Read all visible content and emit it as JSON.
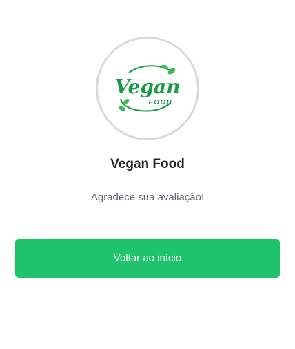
{
  "logo": {
    "script_text": "Vegan",
    "sub_text": "FOOD",
    "brand_color": "#1a9a45"
  },
  "store": {
    "name": "Vegan Food"
  },
  "message": {
    "thanks": "Agradece sua avaliação!"
  },
  "actions": {
    "back_home_label": "Voltar ao início",
    "accent_color": "#1fc36d"
  }
}
